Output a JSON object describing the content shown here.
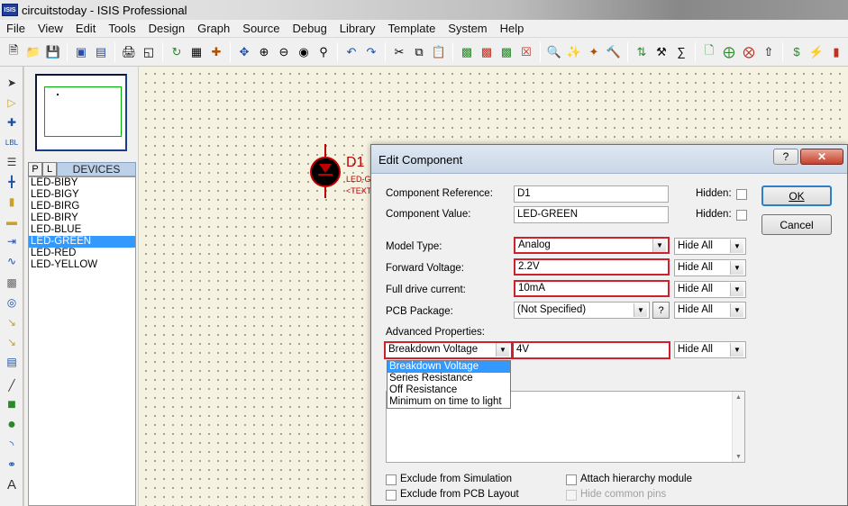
{
  "window": {
    "logo": "ISIS",
    "title": "circuitstoday - ISIS Professional"
  },
  "menu": [
    "File",
    "View",
    "Edit",
    "Tools",
    "Design",
    "Graph",
    "Source",
    "Debug",
    "Library",
    "Template",
    "System",
    "Help"
  ],
  "device_panel": {
    "tab_p": "P",
    "tab_l": "L",
    "header": "DEVICES",
    "items": [
      "LED-BIBY",
      "LED-BIGY",
      "LED-BIRG",
      "LED-BIRY",
      "LED-BLUE",
      "LED-GREEN",
      "LED-RED",
      "LED-YELLOW"
    ],
    "selected_index": 5
  },
  "schematic": {
    "ref": "D1",
    "value_partial": "LED-G",
    "text_partial": "<TEXT"
  },
  "dialog": {
    "title": "Edit Component",
    "help_label": "?",
    "close_label": "✕",
    "component_reference_label": "Component Reference:",
    "component_reference_value": "D1",
    "component_value_label": "Component Value:",
    "component_value_value": "LED-GREEN",
    "hidden_label": "Hidden:",
    "model_type_label": "Model Type:",
    "model_type_value": "Analog",
    "forward_voltage_label": "Forward Voltage:",
    "forward_voltage_value": "2.2V",
    "full_drive_label": "Full drive current:",
    "full_drive_value": "10mA",
    "pcb_package_label": "PCB Package:",
    "pcb_package_value": "(Not Specified)",
    "pcb_help_label": "?",
    "hide_all": "Hide All",
    "advanced_label": "Advanced Properties:",
    "advanced_property_value": "Breakdown Voltage",
    "advanced_property_field": "4V",
    "advanced_options": [
      "Breakdown Voltage",
      "Series Resistance",
      "Off Resistance",
      "Minimum on time to light"
    ],
    "ok_label": "OK",
    "cancel_label": "Cancel",
    "exclude_simulation": "Exclude from Simulation",
    "exclude_pcb": "Exclude from PCB Layout",
    "attach_hierarchy": "Attach hierarchy module",
    "hide_common_pins": "Hide common pins"
  },
  "colors": {
    "highlight_border": "#d0202c",
    "selection": "#3399ff",
    "schematic_red": "#c00000",
    "canvas_bg": "#f6f2e2"
  }
}
